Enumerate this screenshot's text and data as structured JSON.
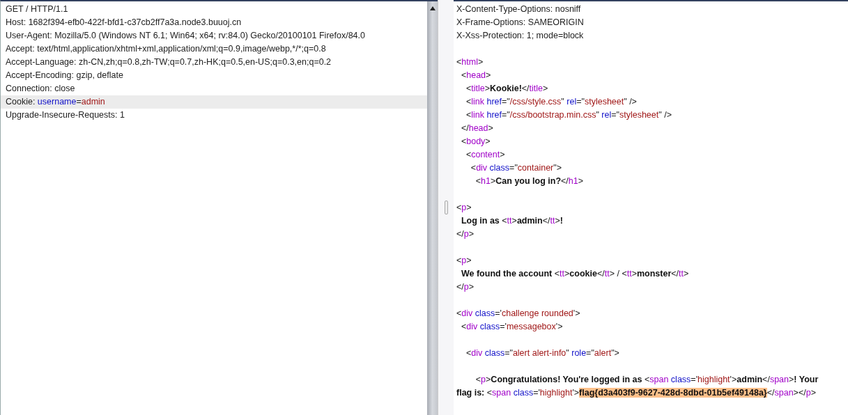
{
  "request": {
    "lines": [
      {
        "selected": false,
        "tokens": [
          {
            "kind": "plain",
            "text": "GET / HTTP/1.1"
          }
        ]
      },
      {
        "selected": false,
        "tokens": [
          {
            "kind": "plain",
            "text": "Host: 1682f394-efb0-422f-bfd1-c37cb2ff7a3a.node3.buuoj.cn"
          }
        ]
      },
      {
        "selected": false,
        "tokens": [
          {
            "kind": "plain",
            "text": "User-Agent: Mozilla/5.0 (Windows NT 6.1; Win64; x64; rv:84.0) Gecko/20100101 Firefox/84.0"
          }
        ]
      },
      {
        "selected": false,
        "tokens": [
          {
            "kind": "plain",
            "text": "Accept: text/html,application/xhtml+xml,application/xml;q=0.9,image/webp,*/*;q=0.8"
          }
        ]
      },
      {
        "selected": false,
        "tokens": [
          {
            "kind": "plain",
            "text": "Accept-Language: zh-CN,zh;q=0.8,zh-TW;q=0.7,zh-HK;q=0.5,en-US;q=0.3,en;q=0.2"
          }
        ]
      },
      {
        "selected": false,
        "tokens": [
          {
            "kind": "plain",
            "text": "Accept-Encoding: gzip, deflate"
          }
        ]
      },
      {
        "selected": false,
        "tokens": [
          {
            "kind": "plain",
            "text": "Connection: close"
          }
        ]
      },
      {
        "selected": true,
        "tokens": [
          {
            "kind": "plain",
            "text": "Cookie: "
          },
          {
            "kind": "attr",
            "text": "username"
          },
          {
            "kind": "plain",
            "text": "="
          },
          {
            "kind": "value",
            "text": "admin"
          }
        ]
      },
      {
        "selected": false,
        "tokens": [
          {
            "kind": "plain",
            "text": "Upgrade-Insecure-Requests: 1"
          }
        ]
      }
    ]
  },
  "response": {
    "lines": [
      {
        "kind": "text",
        "tokens": [
          {
            "kind": "plain",
            "text": "X-Content-Type-Options: nosniff"
          }
        ]
      },
      {
        "kind": "text",
        "tokens": [
          {
            "kind": "plain",
            "text": "X-Frame-Options: SAMEORIGIN"
          }
        ]
      },
      {
        "kind": "text",
        "tokens": [
          {
            "kind": "plain",
            "text": "X-Xss-Protection: 1; mode=block"
          }
        ]
      },
      {
        "kind": "blank"
      },
      {
        "kind": "text",
        "tokens": [
          {
            "kind": "plain",
            "text": "<"
          },
          {
            "kind": "tag",
            "text": "html"
          },
          {
            "kind": "plain",
            "text": ">"
          }
        ]
      },
      {
        "kind": "text",
        "tokens": [
          {
            "kind": "plain",
            "text": "  <"
          },
          {
            "kind": "tag",
            "text": "head"
          },
          {
            "kind": "plain",
            "text": ">"
          }
        ]
      },
      {
        "kind": "text",
        "tokens": [
          {
            "kind": "plain",
            "text": "    <"
          },
          {
            "kind": "tag",
            "text": "title"
          },
          {
            "kind": "plain",
            "text": ">"
          },
          {
            "kind": "bold",
            "text": "Kookie!"
          },
          {
            "kind": "plain",
            "text": "</"
          },
          {
            "kind": "tag",
            "text": "title"
          },
          {
            "kind": "plain",
            "text": ">"
          }
        ]
      },
      {
        "kind": "text",
        "tokens": [
          {
            "kind": "plain",
            "text": "    <"
          },
          {
            "kind": "tag",
            "text": "link "
          },
          {
            "kind": "attr",
            "text": "href"
          },
          {
            "kind": "plain",
            "text": "=\""
          },
          {
            "kind": "value",
            "text": "/css/style.css"
          },
          {
            "kind": "plain",
            "text": "\" "
          },
          {
            "kind": "attr",
            "text": "rel"
          },
          {
            "kind": "plain",
            "text": "=\""
          },
          {
            "kind": "value",
            "text": "stylesheet"
          },
          {
            "kind": "plain",
            "text": "\" />"
          }
        ]
      },
      {
        "kind": "text",
        "tokens": [
          {
            "kind": "plain",
            "text": "    <"
          },
          {
            "kind": "tag",
            "text": "link "
          },
          {
            "kind": "attr",
            "text": "href"
          },
          {
            "kind": "plain",
            "text": "=\""
          },
          {
            "kind": "value",
            "text": "/css/bootstrap.min.css"
          },
          {
            "kind": "plain",
            "text": "\" "
          },
          {
            "kind": "attr",
            "text": "rel"
          },
          {
            "kind": "plain",
            "text": "=\""
          },
          {
            "kind": "value",
            "text": "stylesheet"
          },
          {
            "kind": "plain",
            "text": "\" />"
          }
        ]
      },
      {
        "kind": "text",
        "tokens": [
          {
            "kind": "plain",
            "text": "  </"
          },
          {
            "kind": "tag",
            "text": "head"
          },
          {
            "kind": "plain",
            "text": ">"
          }
        ]
      },
      {
        "kind": "text",
        "tokens": [
          {
            "kind": "plain",
            "text": "  <"
          },
          {
            "kind": "tag",
            "text": "body"
          },
          {
            "kind": "plain",
            "text": ">"
          }
        ]
      },
      {
        "kind": "text",
        "tokens": [
          {
            "kind": "plain",
            "text": "    <"
          },
          {
            "kind": "tag",
            "text": "content"
          },
          {
            "kind": "plain",
            "text": ">"
          }
        ]
      },
      {
        "kind": "text",
        "tokens": [
          {
            "kind": "plain",
            "text": "      <"
          },
          {
            "kind": "tag",
            "text": "div "
          },
          {
            "kind": "attr",
            "text": "class"
          },
          {
            "kind": "plain",
            "text": "=\""
          },
          {
            "kind": "value",
            "text": "container"
          },
          {
            "kind": "plain",
            "text": "\">"
          }
        ]
      },
      {
        "kind": "text",
        "tokens": [
          {
            "kind": "plain",
            "text": "        <"
          },
          {
            "kind": "tag",
            "text": "h1"
          },
          {
            "kind": "plain",
            "text": ">"
          },
          {
            "kind": "bold",
            "text": "Can you log in?"
          },
          {
            "kind": "plain",
            "text": "</"
          },
          {
            "kind": "tag",
            "text": "h1"
          },
          {
            "kind": "plain",
            "text": ">"
          }
        ]
      },
      {
        "kind": "blank"
      },
      {
        "kind": "text",
        "tokens": [
          {
            "kind": "plain",
            "text": "<"
          },
          {
            "kind": "tag",
            "text": "p"
          },
          {
            "kind": "plain",
            "text": ">"
          }
        ]
      },
      {
        "kind": "text",
        "tokens": [
          {
            "kind": "bold",
            "text": "  Log in as "
          },
          {
            "kind": "plain",
            "text": "<"
          },
          {
            "kind": "tag",
            "text": "tt"
          },
          {
            "kind": "plain",
            "text": ">"
          },
          {
            "kind": "bold",
            "text": "admin"
          },
          {
            "kind": "plain",
            "text": "</"
          },
          {
            "kind": "tag",
            "text": "tt"
          },
          {
            "kind": "plain",
            "text": ">"
          },
          {
            "kind": "bold",
            "text": "!"
          }
        ]
      },
      {
        "kind": "text",
        "tokens": [
          {
            "kind": "plain",
            "text": "</"
          },
          {
            "kind": "tag",
            "text": "p"
          },
          {
            "kind": "plain",
            "text": ">"
          }
        ]
      },
      {
        "kind": "blank"
      },
      {
        "kind": "text",
        "tokens": [
          {
            "kind": "plain",
            "text": "<"
          },
          {
            "kind": "tag",
            "text": "p"
          },
          {
            "kind": "plain",
            "text": ">"
          }
        ]
      },
      {
        "kind": "text",
        "tokens": [
          {
            "kind": "bold",
            "text": "  We found the account "
          },
          {
            "kind": "plain",
            "text": "<"
          },
          {
            "kind": "tag",
            "text": "tt"
          },
          {
            "kind": "plain",
            "text": ">"
          },
          {
            "kind": "bold",
            "text": "cookie"
          },
          {
            "kind": "plain",
            "text": "</"
          },
          {
            "kind": "tag",
            "text": "tt"
          },
          {
            "kind": "plain",
            "text": "> / <"
          },
          {
            "kind": "tag",
            "text": "tt"
          },
          {
            "kind": "plain",
            "text": ">"
          },
          {
            "kind": "bold",
            "text": "monster"
          },
          {
            "kind": "plain",
            "text": "</"
          },
          {
            "kind": "tag",
            "text": "tt"
          },
          {
            "kind": "plain",
            "text": ">"
          }
        ]
      },
      {
        "kind": "text",
        "tokens": [
          {
            "kind": "plain",
            "text": "</"
          },
          {
            "kind": "tag",
            "text": "p"
          },
          {
            "kind": "plain",
            "text": ">"
          }
        ]
      },
      {
        "kind": "blank"
      },
      {
        "kind": "text",
        "tokens": [
          {
            "kind": "plain",
            "text": "<"
          },
          {
            "kind": "tag",
            "text": "div "
          },
          {
            "kind": "attr",
            "text": "class"
          },
          {
            "kind": "plain",
            "text": "='"
          },
          {
            "kind": "value",
            "text": "challenge rounded"
          },
          {
            "kind": "plain",
            "text": "'>"
          }
        ]
      },
      {
        "kind": "text",
        "tokens": [
          {
            "kind": "plain",
            "text": "  <"
          },
          {
            "kind": "tag",
            "text": "div "
          },
          {
            "kind": "attr",
            "text": "class"
          },
          {
            "kind": "plain",
            "text": "='"
          },
          {
            "kind": "value",
            "text": "messagebox"
          },
          {
            "kind": "plain",
            "text": "'>"
          }
        ]
      },
      {
        "kind": "blank"
      },
      {
        "kind": "text",
        "tokens": [
          {
            "kind": "plain",
            "text": "    <"
          },
          {
            "kind": "tag",
            "text": "div "
          },
          {
            "kind": "attr",
            "text": "class"
          },
          {
            "kind": "plain",
            "text": "=\""
          },
          {
            "kind": "value",
            "text": "alert alert-info"
          },
          {
            "kind": "plain",
            "text": "\" "
          },
          {
            "kind": "attr",
            "text": "role"
          },
          {
            "kind": "plain",
            "text": "=\""
          },
          {
            "kind": "value",
            "text": "alert"
          },
          {
            "kind": "plain",
            "text": "\">"
          }
        ]
      },
      {
        "kind": "blank"
      },
      {
        "kind": "text",
        "tokens": [
          {
            "kind": "plain",
            "text": "        <"
          },
          {
            "kind": "tag",
            "text": "p"
          },
          {
            "kind": "plain",
            "text": ">"
          },
          {
            "kind": "bold",
            "text": "Congratulations! You're logged in as "
          },
          {
            "kind": "plain",
            "text": "<"
          },
          {
            "kind": "tag",
            "text": "span "
          },
          {
            "kind": "attr",
            "text": "class"
          },
          {
            "kind": "plain",
            "text": "='"
          },
          {
            "kind": "value",
            "text": "highlight"
          },
          {
            "kind": "plain",
            "text": "'>"
          },
          {
            "kind": "bold",
            "text": "admin"
          },
          {
            "kind": "plain",
            "text": "</"
          },
          {
            "kind": "tag",
            "text": "span"
          },
          {
            "kind": "plain",
            "text": ">"
          },
          {
            "kind": "bold",
            "text": "! Your"
          }
        ]
      },
      {
        "kind": "text",
        "tokens": [
          {
            "kind": "bold",
            "text": "flag is: "
          },
          {
            "kind": "plain",
            "text": "<"
          },
          {
            "kind": "tag",
            "text": "span "
          },
          {
            "kind": "attr",
            "text": "class"
          },
          {
            "kind": "plain",
            "text": "='"
          },
          {
            "kind": "value",
            "text": "highlight"
          },
          {
            "kind": "plain",
            "text": "'>"
          },
          {
            "kind": "flag",
            "text": "flag{d3a403f9-9627-428d-8dbd-01b5ef49148a}"
          },
          {
            "kind": "plain",
            "text": "</"
          },
          {
            "kind": "tag",
            "text": "span"
          },
          {
            "kind": "plain",
            "text": "></"
          },
          {
            "kind": "tag",
            "text": "p"
          },
          {
            "kind": "plain",
            "text": ">"
          }
        ]
      }
    ]
  }
}
